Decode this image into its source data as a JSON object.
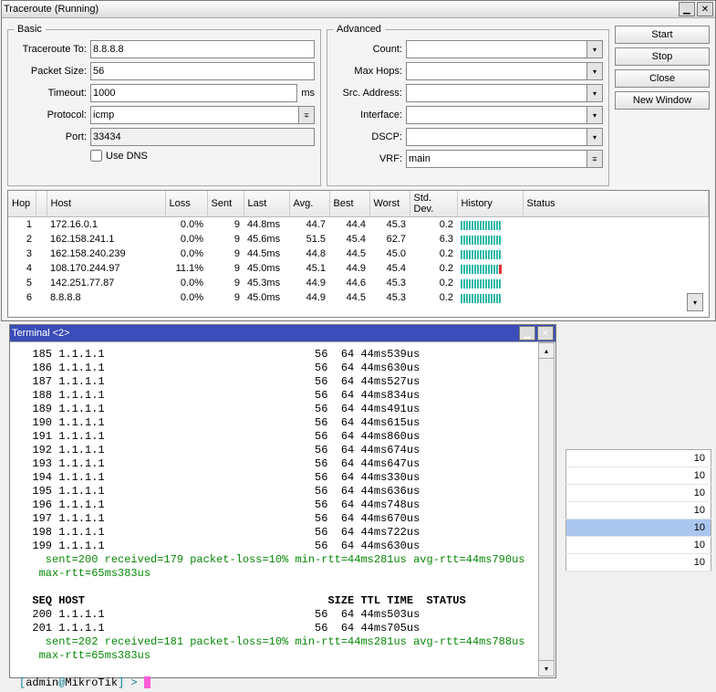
{
  "tracewin": {
    "title": "Traceroute (Running)",
    "actions": {
      "start": "Start",
      "stop": "Stop",
      "close": "Close",
      "newwin": "New Window"
    },
    "basic": {
      "legend": "Basic",
      "traceroute_to_lbl": "Traceroute To:",
      "traceroute_to": "8.8.8.8",
      "packet_size_lbl": "Packet Size:",
      "packet_size": "56",
      "timeout_lbl": "Timeout:",
      "timeout": "1000",
      "timeout_unit": "ms",
      "protocol_lbl": "Protocol:",
      "protocol": "icmp",
      "port_lbl": "Port:",
      "port": "33434",
      "use_dns": "Use DNS",
      "use_dns_checked": false
    },
    "advanced": {
      "legend": "Advanced",
      "count_lbl": "Count:",
      "count": "",
      "max_hops_lbl": "Max Hops:",
      "max_hops": "",
      "src_address_lbl": "Src. Address:",
      "src_address": "",
      "interface_lbl": "Interface:",
      "interface": "",
      "dscp_lbl": "DSCP:",
      "dscp": "",
      "vrf_lbl": "VRF:",
      "vrf": "main"
    },
    "grid": {
      "cols": [
        "Hop",
        "",
        "Host",
        "Loss",
        "Sent",
        "Last",
        "Avg.",
        "Best",
        "Worst",
        "Std. Dev.",
        "History",
        "Status"
      ],
      "rows": [
        {
          "hop": "1",
          "host": "172.16.0.1",
          "loss": "0.0%",
          "sent": "9",
          "last": "44.8ms",
          "avg": "44.7",
          "best": "44.4",
          "worst": "45.3",
          "sd": "0.2",
          "hist": "nnnnnnnnnnnnnnn"
        },
        {
          "hop": "2",
          "host": "162.158.241.1",
          "loss": "0.0%",
          "sent": "9",
          "last": "45.6ms",
          "avg": "51.5",
          "best": "45.4",
          "worst": "62.7",
          "sd": "6.3",
          "hist": "nnnnnnnnnnnnnnn"
        },
        {
          "hop": "3",
          "host": "162.158.240.239",
          "loss": "0.0%",
          "sent": "9",
          "last": "44.5ms",
          "avg": "44.8",
          "best": "44.5",
          "worst": "45.0",
          "sd": "0.2",
          "hist": "nnnnnnnnnnnnnnn"
        },
        {
          "hop": "4",
          "host": "108.170.244.97",
          "loss": "11.1%",
          "sent": "9",
          "last": "45.0ms",
          "avg": "45.1",
          "best": "44.9",
          "worst": "45.4",
          "sd": "0.2",
          "hist": "nnnnnnnnnnnnnnR"
        },
        {
          "hop": "5",
          "host": "142.251.77.87",
          "loss": "0.0%",
          "sent": "9",
          "last": "45.3ms",
          "avg": "44.9",
          "best": "44.6",
          "worst": "45.3",
          "sd": "0.2",
          "hist": "nnnnnnnnnnnnnnn"
        },
        {
          "hop": "6",
          "host": "8.8.8.8",
          "loss": "0.0%",
          "sent": "9",
          "last": "45.0ms",
          "avg": "44.9",
          "best": "44.5",
          "worst": "45.3",
          "sd": "0.2",
          "hist": "nnnnnnnnnnnnnnn"
        }
      ]
    }
  },
  "terminal": {
    "title": "Terminal <2>",
    "lines": [
      {
        "seq": "185",
        "host": "1.1.1.1",
        "size": "56",
        "ttl": "64",
        "time": "44ms539us"
      },
      {
        "seq": "186",
        "host": "1.1.1.1",
        "size": "56",
        "ttl": "64",
        "time": "44ms630us"
      },
      {
        "seq": "187",
        "host": "1.1.1.1",
        "size": "56",
        "ttl": "64",
        "time": "44ms527us"
      },
      {
        "seq": "188",
        "host": "1.1.1.1",
        "size": "56",
        "ttl": "64",
        "time": "44ms834us"
      },
      {
        "seq": "189",
        "host": "1.1.1.1",
        "size": "56",
        "ttl": "64",
        "time": "44ms491us"
      },
      {
        "seq": "190",
        "host": "1.1.1.1",
        "size": "56",
        "ttl": "64",
        "time": "44ms615us"
      },
      {
        "seq": "191",
        "host": "1.1.1.1",
        "size": "56",
        "ttl": "64",
        "time": "44ms860us"
      },
      {
        "seq": "192",
        "host": "1.1.1.1",
        "size": "56",
        "ttl": "64",
        "time": "44ms674us"
      },
      {
        "seq": "193",
        "host": "1.1.1.1",
        "size": "56",
        "ttl": "64",
        "time": "44ms647us"
      },
      {
        "seq": "194",
        "host": "1.1.1.1",
        "size": "56",
        "ttl": "64",
        "time": "44ms330us"
      },
      {
        "seq": "195",
        "host": "1.1.1.1",
        "size": "56",
        "ttl": "64",
        "time": "44ms636us"
      },
      {
        "seq": "196",
        "host": "1.1.1.1",
        "size": "56",
        "ttl": "64",
        "time": "44ms748us"
      },
      {
        "seq": "197",
        "host": "1.1.1.1",
        "size": "56",
        "ttl": "64",
        "time": "44ms670us"
      },
      {
        "seq": "198",
        "host": "1.1.1.1",
        "size": "56",
        "ttl": "64",
        "time": "44ms722us"
      },
      {
        "seq": "199",
        "host": "1.1.1.1",
        "size": "56",
        "ttl": "64",
        "time": "44ms630us"
      }
    ],
    "stat1a": "    sent=200 received=179 packet-loss=10% min-rtt=44ms281us avg-rtt=44ms790us",
    "stat1b": "   max-rtt=65ms383us",
    "header": "  SEQ HOST                                     SIZE TTL TIME  STATUS",
    "lines2": [
      {
        "seq": "200",
        "host": "1.1.1.1",
        "size": "56",
        "ttl": "64",
        "time": "44ms503us"
      },
      {
        "seq": "201",
        "host": "1.1.1.1",
        "size": "56",
        "ttl": "64",
        "time": "44ms705us"
      }
    ],
    "stat2a": "    sent=202 received=181 packet-loss=10% min-rtt=44ms281us avg-rtt=44ms788us",
    "stat2b": "   max-rtt=65ms383us",
    "prompt_open": "[",
    "prompt_user": "admin",
    "prompt_at": "@",
    "prompt_host": "MikroTik",
    "prompt_close": "] > "
  },
  "bgtable": {
    "rows": [
      "10",
      "10",
      "10",
      "10",
      "10",
      "10",
      "10"
    ],
    "sel": 4
  }
}
